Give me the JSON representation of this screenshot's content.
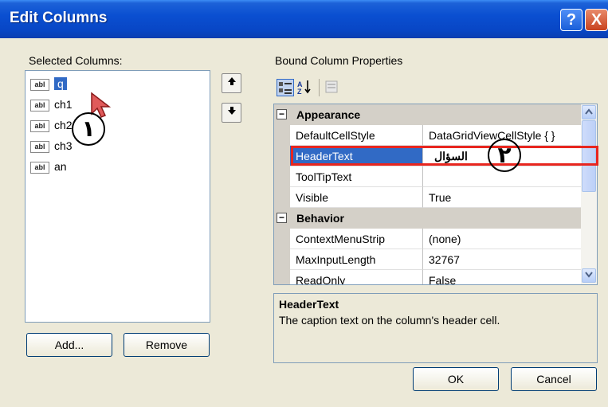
{
  "window": {
    "title": "Edit Columns",
    "help_glyph": "?",
    "close_glyph": "X"
  },
  "left": {
    "label": "Selected Columns:",
    "columns": [
      {
        "icon": "abl",
        "name": "q",
        "selected": true
      },
      {
        "icon": "abl",
        "name": "ch1"
      },
      {
        "icon": "abl",
        "name": "ch2"
      },
      {
        "icon": "abl",
        "name": "ch3"
      },
      {
        "icon": "abl",
        "name": "an"
      }
    ],
    "move_up_glyph": "🠉",
    "move_down_glyph": "🠋",
    "add_label": "Add...",
    "remove_label": "Remove"
  },
  "right": {
    "label": "Bound Column Properties",
    "categories": [
      {
        "name": "Appearance",
        "expander": "⊟",
        "props": [
          {
            "name": "DefaultCellStyle",
            "value": "DataGridViewCellStyle { }"
          },
          {
            "name": "HeaderText",
            "value": "السؤال",
            "selected": true
          },
          {
            "name": "ToolTipText",
            "value": ""
          },
          {
            "name": "Visible",
            "value": "True"
          }
        ]
      },
      {
        "name": "Behavior",
        "expander": "⊟",
        "props": [
          {
            "name": "ContextMenuStrip",
            "value": "(none)"
          },
          {
            "name": "MaxInputLength",
            "value": "32767"
          },
          {
            "name": "ReadOnly",
            "value": "False"
          }
        ]
      }
    ],
    "description_title": "HeaderText",
    "description_text": "The caption text on the column's header cell."
  },
  "footer": {
    "ok_label": "OK",
    "cancel_label": "Cancel"
  },
  "annotations": {
    "one": "١",
    "two": "٢"
  },
  "colors": {
    "title_bar": "#0a4fd1",
    "selection": "#316ac5",
    "highlight_box": "#e8261f"
  }
}
